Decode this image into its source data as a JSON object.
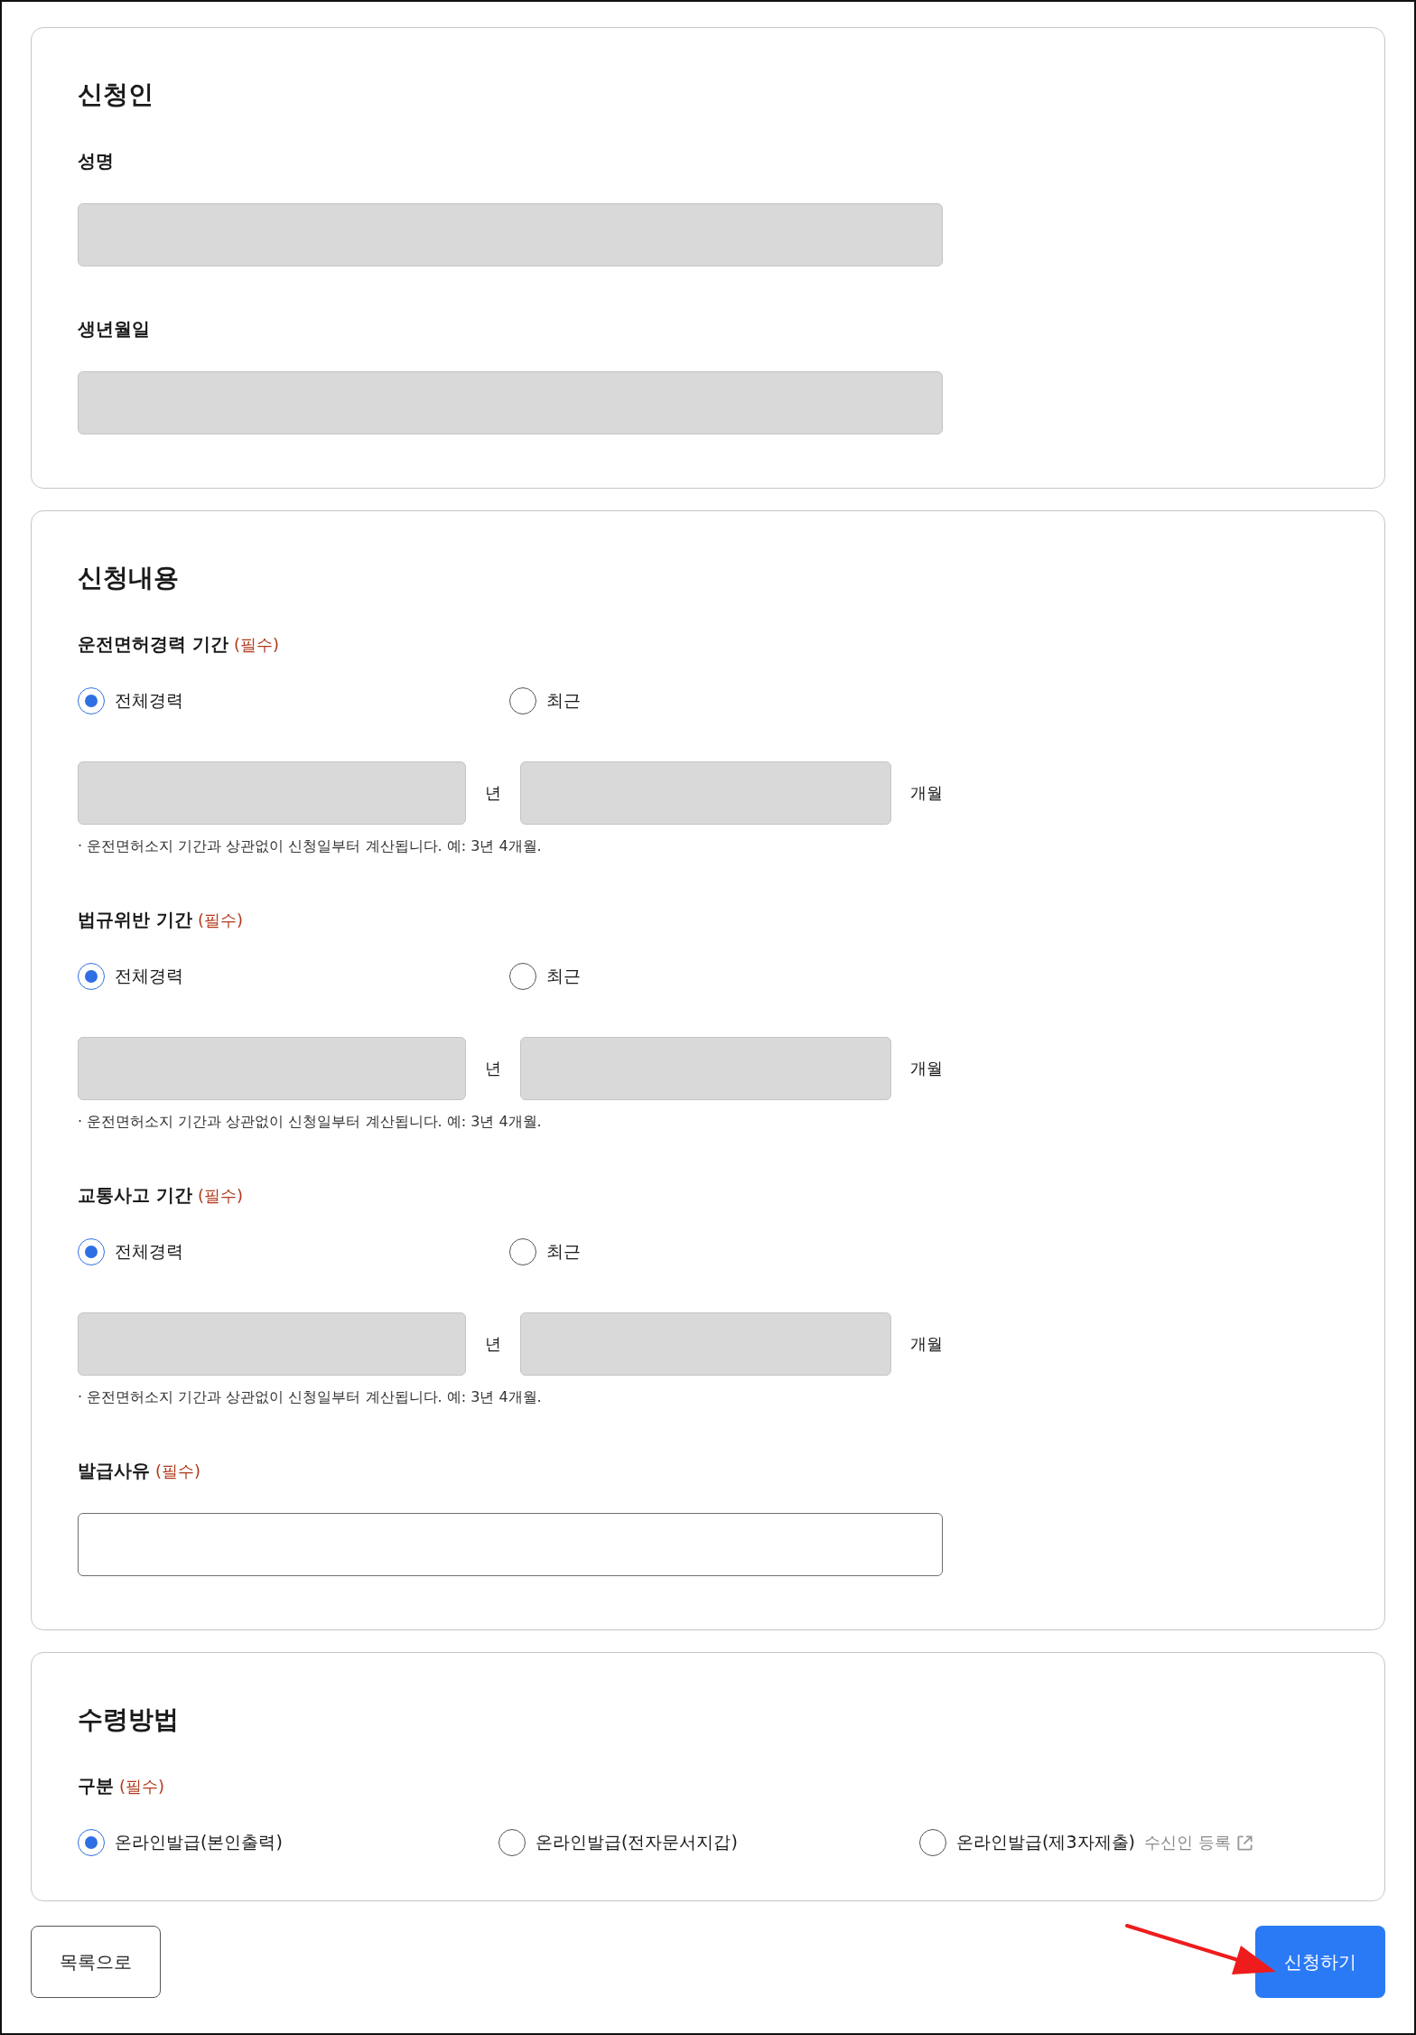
{
  "sections": [
    {
      "title": "신청인",
      "fields": [
        {
          "kind": "input",
          "label": "성명",
          "disabled": true
        },
        {
          "kind": "input",
          "label": "생년월일",
          "disabled": true
        }
      ]
    },
    {
      "title": "신청내용",
      "fields": [
        {
          "kind": "period",
          "label": "운전면허경력 기간",
          "required": "(필수)",
          "options": [
            {
              "label": "전체경력",
              "selected": true
            },
            {
              "label": "최근",
              "selected": false
            }
          ],
          "inputs": [
            {
              "unit": "년",
              "disabled": true
            },
            {
              "unit": "개월",
              "disabled": true
            }
          ],
          "note": "· 운전면허소지 기간과 상관없이 신청일부터 계산됩니다. 예: 3년 4개월."
        },
        {
          "kind": "period",
          "label": "법규위반 기간",
          "required": "(필수)",
          "options": [
            {
              "label": "전체경력",
              "selected": true
            },
            {
              "label": "최근",
              "selected": false
            }
          ],
          "inputs": [
            {
              "unit": "년",
              "disabled": true
            },
            {
              "unit": "개월",
              "disabled": true
            }
          ],
          "note": "· 운전면허소지 기간과 상관없이 신청일부터 계산됩니다. 예: 3년 4개월."
        },
        {
          "kind": "period",
          "label": "교통사고 기간",
          "required": "(필수)",
          "options": [
            {
              "label": "전체경력",
              "selected": true
            },
            {
              "label": "최근",
              "selected": false
            }
          ],
          "inputs": [
            {
              "unit": "년",
              "disabled": true
            },
            {
              "unit": "개월",
              "disabled": true
            }
          ],
          "note": "· 운전면허소지 기간과 상관없이 신청일부터 계산됩니다. 예: 3년 4개월."
        },
        {
          "kind": "input",
          "label": "발급사유",
          "required": "(필수)",
          "disabled": false
        }
      ]
    },
    {
      "title": "수령방법",
      "fields": [
        {
          "kind": "choice",
          "label": "구분",
          "required": "(필수)",
          "options": [
            {
              "label": "온라인발급(본인출력)",
              "selected": true
            },
            {
              "label": "온라인발급(전자문서지갑)",
              "selected": false
            },
            {
              "label": "온라인발급(제3자제출)",
              "selected": false,
              "link": "수신인 등록"
            }
          ]
        }
      ]
    }
  ],
  "buttons": [
    {
      "label": "목록으로",
      "kind": "secondary"
    },
    {
      "label": "신청하기",
      "kind": "primary"
    }
  ]
}
